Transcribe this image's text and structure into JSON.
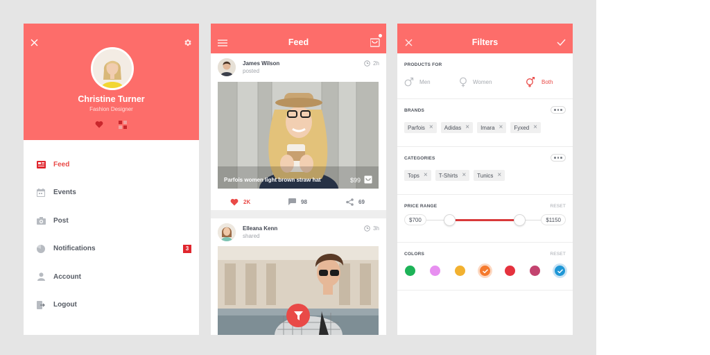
{
  "profile": {
    "name": "Christine Turner",
    "role": "Fashion Designer",
    "menu": [
      {
        "label": "Feed",
        "icon": "feed-icon",
        "active": true
      },
      {
        "label": "Events",
        "icon": "calendar-icon"
      },
      {
        "label": "Post",
        "icon": "camera-icon"
      },
      {
        "label": "Notifications",
        "icon": "notification-icon",
        "badge": "3"
      },
      {
        "label": "Account",
        "icon": "user-icon"
      },
      {
        "label": "Logout",
        "icon": "logout-icon"
      }
    ]
  },
  "feed": {
    "title": "Feed",
    "posts": [
      {
        "author": "James Wilson",
        "action": "posted",
        "time": "2h",
        "caption": "Parfois women light brown straw hat",
        "price": "$99",
        "likes": "2K",
        "comments": "98",
        "shares": "69"
      },
      {
        "author": "Elleana Kenn",
        "action": "shared",
        "time": "3h"
      }
    ]
  },
  "filters": {
    "title": "Filters",
    "products_for": {
      "label": "PRODUCTS FOR",
      "options": [
        "Men",
        "Women",
        "Both"
      ],
      "selected": "Both"
    },
    "brands": {
      "label": "BRANDS",
      "chips": [
        "Parfois",
        "Adidas",
        "Imara",
        "Fyxed"
      ]
    },
    "categories": {
      "label": "CATEGORIES",
      "chips": [
        "Tops",
        "T-Shirts",
        "Tunics"
      ]
    },
    "price_range": {
      "label": "PRICE RANGE",
      "reset": "RESET",
      "min": "$700",
      "max": "$1150"
    },
    "colors": {
      "label": "COLORS",
      "reset": "RESET",
      "swatches": [
        "#1db358",
        "#e78ff0",
        "#f2b130",
        "#f57a2d",
        "#e5323e",
        "#c3436f",
        "#1f97d6"
      ],
      "selected": [
        3,
        6
      ]
    }
  },
  "theme": {
    "accent": "#fd6d6a",
    "accent_dark": "#e94a47"
  }
}
